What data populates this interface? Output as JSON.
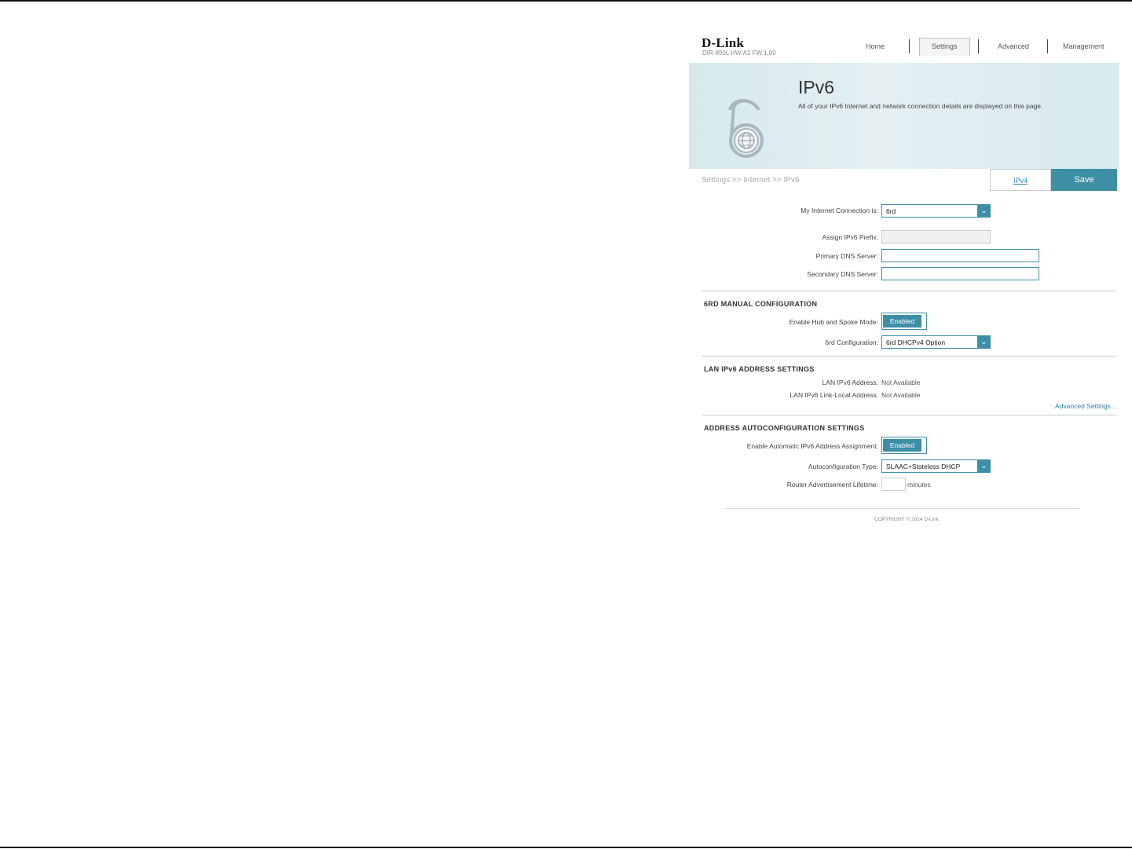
{
  "header": {
    "logo": "D-Link",
    "model_info": "DIR-890L   HW:A1   FW:1.00",
    "nav": [
      "Home",
      "Settings",
      "Advanced",
      "Management"
    ]
  },
  "banner": {
    "title": "IPv6",
    "description": "All of your IPv6 Internet and network connection details are displayed on this page."
  },
  "breadcrumb": "Settings >> Internet >> IPv6",
  "actions": {
    "ipv4_label": "IPv4",
    "save_label": "Save"
  },
  "form": {
    "connection_label": "My Internet Connection is:",
    "connection_value": "6rd",
    "prefix_label": "Assign IPv6 Prefix:",
    "primary_dns_label": "Primary DNS Server:",
    "secondary_dns_label": "Secondary DNS Server:"
  },
  "sixrd": {
    "title": "6RD MANUAL CONFIGURATION",
    "hub_label": "Enable Hub and Spoke Mode:",
    "hub_value": "Enabled",
    "config_label": "6rd Configuration:",
    "config_value": "6rd DHCPv4 Option"
  },
  "lan": {
    "title": "LAN IPv6 ADDRESS SETTINGS",
    "address_label": "LAN IPv6 Address:",
    "address_value": "Not Available",
    "linklocal_label": "LAN IPv6 Link-Local Address:",
    "linklocal_value": "Not Available",
    "advanced_link": "Advanced Settings..."
  },
  "autoconfig": {
    "title": "ADDRESS AUTOCONFIGURATION SETTINGS",
    "enable_label": "Enable Automatic IPv6 Address Assignment:",
    "enable_value": "Enabled",
    "type_label": "Autoconfiguration Type:",
    "type_value": "SLAAC+Stateless DHCP",
    "lifetime_label": "Router Advertisement Lifetime:",
    "lifetime_unit": "minutes"
  },
  "footer": "COPYRIGHT © 2014 D-Link",
  "colors": {
    "accent": "#3d8fa5",
    "link": "#2c7fb0",
    "banner": "#dceced"
  },
  "icons": [
    "ipv6-globe-icon",
    "chevron-down-icon"
  ]
}
